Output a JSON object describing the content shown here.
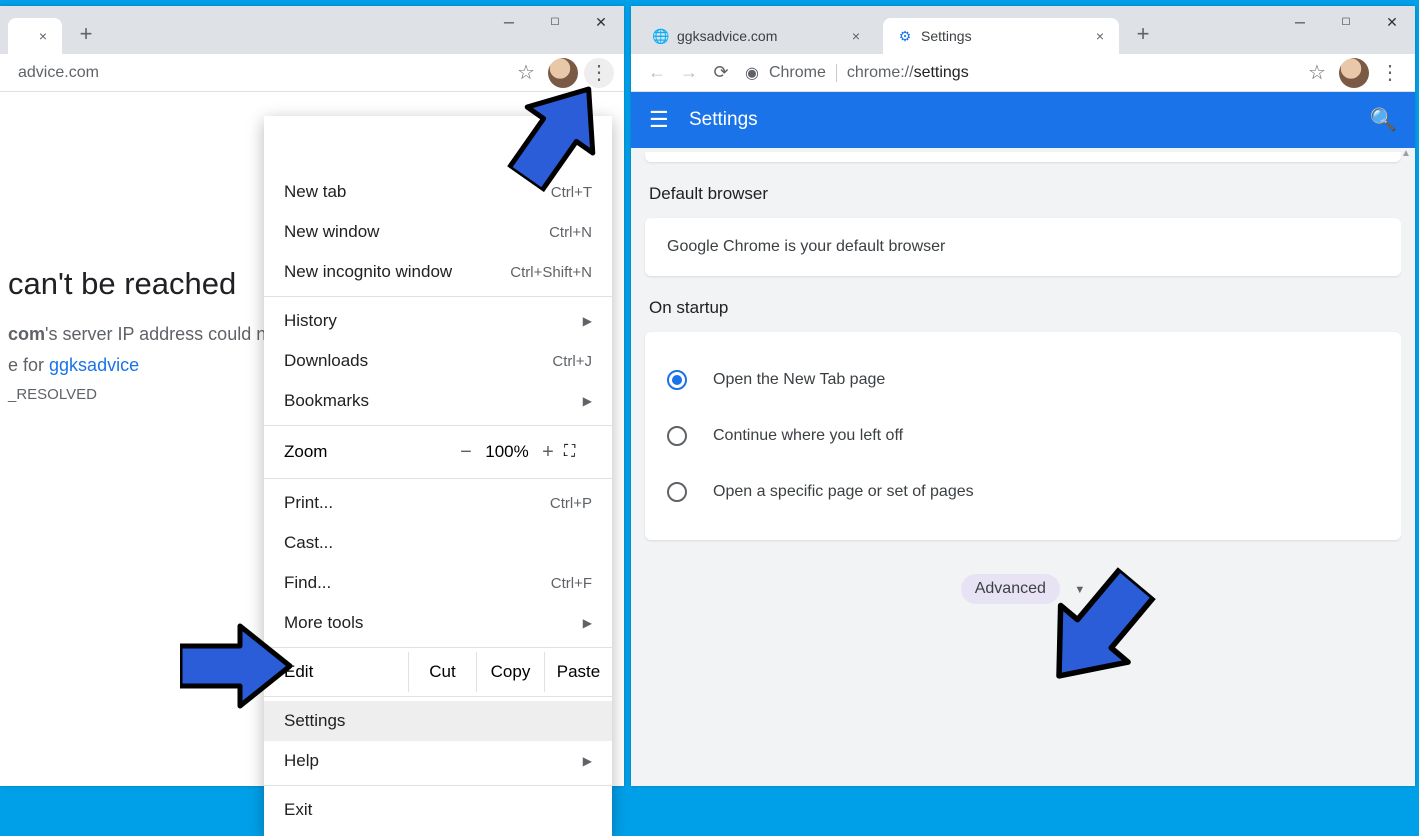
{
  "left": {
    "tab_close": "×",
    "omnibar_url": "advice.com",
    "error": {
      "title": "can't be reached",
      "line1_suffix": "'s server IP address could n",
      "line1_bold": "com",
      "search_prefix": "e for ",
      "search_link": "ggksadvice",
      "code": "_RESOLVED"
    },
    "menu": {
      "new_tab": "New tab",
      "new_tab_k": "Ctrl+T",
      "new_window": "New window",
      "new_window_k": "Ctrl+N",
      "incognito": "New incognito window",
      "incognito_k": "Ctrl+Shift+N",
      "history": "History",
      "downloads": "Downloads",
      "downloads_k": "Ctrl+J",
      "bookmarks": "Bookmarks",
      "zoom": "Zoom",
      "zoom_val": "100%",
      "print": "Print...",
      "print_k": "Ctrl+P",
      "cast": "Cast...",
      "find": "Find...",
      "find_k": "Ctrl+F",
      "more": "More tools",
      "edit": "Edit",
      "cut": "Cut",
      "copy": "Copy",
      "paste": "Paste",
      "settings": "Settings",
      "help": "Help",
      "exit": "Exit"
    }
  },
  "right": {
    "tabs": [
      {
        "label": "ggksadvice.com"
      },
      {
        "label": "Settings"
      }
    ],
    "omnibar": {
      "chip": "Chrome",
      "url_prefix": "chrome://",
      "url_bold": "settings"
    },
    "appbar_title": "Settings",
    "default_browser_h": "Default browser",
    "default_browser_text": "Google Chrome is your default browser",
    "startup_h": "On startup",
    "startup": [
      "Open the New Tab page",
      "Continue where you left off",
      "Open a specific page or set of pages"
    ],
    "advanced": "Advanced"
  }
}
